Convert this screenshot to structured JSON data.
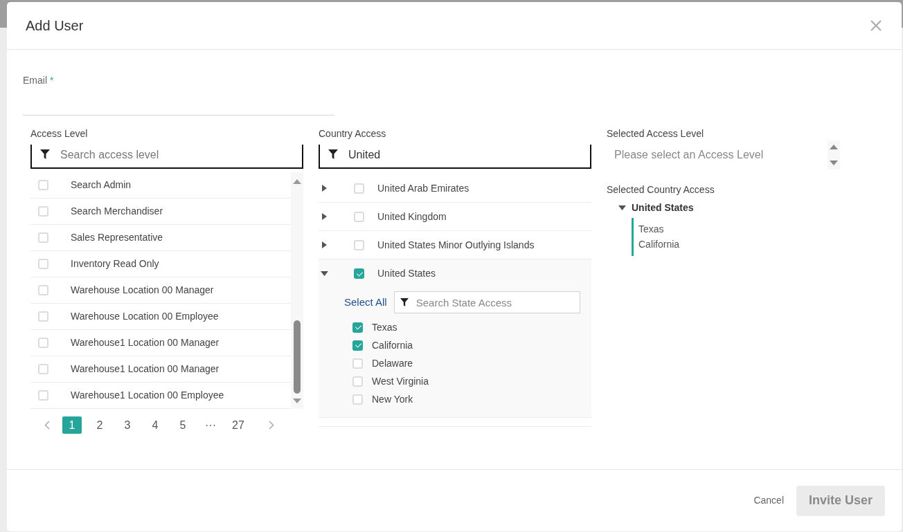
{
  "dialog": {
    "title": "Add User"
  },
  "email": {
    "label": "Email",
    "required_mark": "*"
  },
  "access_level": {
    "label": "Access Level",
    "search": {
      "placeholder": "Search access level"
    },
    "items": [
      {
        "label": "Search Admin",
        "checked": false
      },
      {
        "label": "Search Merchandiser",
        "checked": false
      },
      {
        "label": "Sales Representative",
        "checked": false
      },
      {
        "label": "Inventory Read Only",
        "checked": false
      },
      {
        "label": "Warehouse Location 00 Manager",
        "checked": false
      },
      {
        "label": "Warehouse Location 00 Employee",
        "checked": false
      },
      {
        "label": "Warehouse1 Location 00 Manager",
        "checked": false
      },
      {
        "label": "Warehouse1 Location 00 Manager",
        "checked": false
      },
      {
        "label": "Warehouse1 Location 00 Employee",
        "checked": false
      }
    ],
    "pages": [
      {
        "label": "1",
        "selected": true
      },
      {
        "label": "2",
        "selected": false
      },
      {
        "label": "3",
        "selected": false
      },
      {
        "label": "4",
        "selected": false
      },
      {
        "label": "5",
        "selected": false
      },
      {
        "label": "···",
        "selected": false
      },
      {
        "label": "27",
        "selected": false
      }
    ]
  },
  "country_access": {
    "label": "Country Access",
    "search": {
      "value": "United"
    },
    "countries": [
      {
        "name": "United Arab Emirates",
        "expanded": false,
        "checked": false
      },
      {
        "name": "United Kingdom",
        "expanded": false,
        "checked": false
      },
      {
        "name": "United States Minor Outlying Islands",
        "expanded": false,
        "checked": false
      },
      {
        "name": "United States",
        "expanded": true,
        "checked": true,
        "select_all": "Select All",
        "state_search": {
          "placeholder": "Search State Access"
        },
        "states": [
          {
            "name": "Texas",
            "checked": true
          },
          {
            "name": "California",
            "checked": true
          },
          {
            "name": "Delaware",
            "checked": false
          },
          {
            "name": "West Virginia",
            "checked": false
          },
          {
            "name": "New York",
            "checked": false
          }
        ]
      }
    ]
  },
  "selected_access_level": {
    "label": "Selected Access Level",
    "placeholder": "Please select an Access Level"
  },
  "selected_country_access": {
    "label": "Selected Country Access",
    "countries": [
      {
        "name": "United States",
        "expanded": true,
        "states": [
          "Texas",
          "California"
        ]
      }
    ]
  },
  "footer": {
    "cancel": "Cancel",
    "submit": {
      "label": "Invite User",
      "disabled": true
    }
  }
}
